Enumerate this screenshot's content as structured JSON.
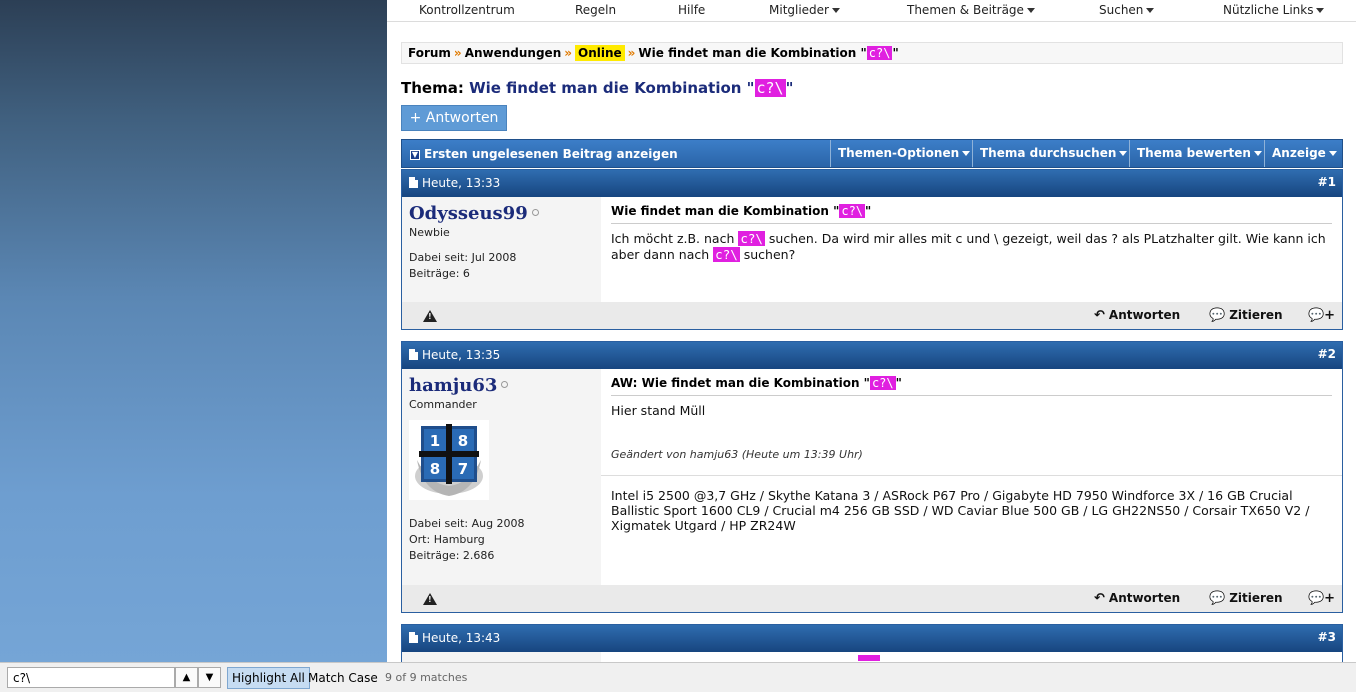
{
  "nav": {
    "items": [
      {
        "label": "Kontrollzentrum",
        "dropdown": false
      },
      {
        "label": "Regeln",
        "dropdown": false
      },
      {
        "label": "Hilfe",
        "dropdown": false
      },
      {
        "label": "Mitglieder",
        "dropdown": true
      },
      {
        "label": "Themen & Beiträge",
        "dropdown": true
      },
      {
        "label": "Suchen",
        "dropdown": true
      },
      {
        "label": "Nützliche Links",
        "dropdown": true
      }
    ]
  },
  "breadcrumb": {
    "forum": "Forum",
    "anwendungen": "Anwendungen",
    "online": "Online",
    "thread": "Wie findet man die Kombination \"",
    "hl": "c?\\",
    "end": "\"",
    "sep": "»"
  },
  "thread": {
    "prefix": "Thema:",
    "title_a": "Wie findet man die Kombination \"",
    "hl": "c?\\",
    "title_b": "\""
  },
  "reply_button": "+ Antworten",
  "tools": {
    "first_unread": "Ersten ungelesenen Beitrag anzeigen",
    "options": "Themen-Optionen",
    "search": "Thema durchsuchen",
    "rate": "Thema bewerten",
    "display": "Anzeige"
  },
  "posts": [
    {
      "date": "Heute, 13:33",
      "num": "#1",
      "username": "Odysseus99",
      "usertitle": "Newbie",
      "joined": "Dabei seit: Jul 2008",
      "posts": "Beiträge: 6",
      "title_a": "Wie findet man die Kombination \"",
      "title_hl": "c?\\",
      "title_b": "\"",
      "text_a": "Ich möcht z.B. nach ",
      "text_hl1": "c?\\",
      "text_b": " suchen. Da wird mir alles mit c und \\ gezeigt, weil das ? als PLatzhalter gilt. Wie kann ich aber dann nach ",
      "text_hl2": "c?\\",
      "text_c": " suchen?",
      "reply": "Antworten",
      "quote": "Zitieren"
    },
    {
      "date": "Heute, 13:35",
      "num": "#2",
      "username": "hamju63",
      "usertitle": "Commander",
      "joined": "Dabei seit: Aug 2008",
      "location": "Ort: Hamburg",
      "posts": "Beiträge: 2.686",
      "title_a": "AW: Wie findet man die Kombination \"",
      "title_hl": "c?\\",
      "title_b": "\"",
      "text": "Hier stand Müll",
      "edit_a": "Geändert von hamju63 (Heute um ",
      "edit_time": "13:39",
      "edit_b": " Uhr)",
      "signature": "Intel i5 2500 @3,7 GHz / Skythe Katana 3 / ASRock P67 Pro / Gigabyte HD 7950 Windforce 3X / 16 GB Crucial Ballistic Sport 1600 CL9 / Crucial m4 256 GB SSD / WD Caviar Blue 500 GB / LG GH22NS50 / Corsair TX650 V2 / Xigmatek Utgard / HP ZR24W",
      "avatar_digits": [
        "1",
        "8",
        "8",
        "7"
      ],
      "reply": "Antworten",
      "quote": "Zitieren"
    },
    {
      "date": "Heute, 13:43",
      "num": "#3"
    }
  ],
  "findbar": {
    "value": "c?\\",
    "highlight_all": "Highlight All",
    "match_case": "Match Case",
    "count": "9 of 9 matches"
  },
  "colors": {
    "accent": "#2a5fa0",
    "highlight": "#e020e0",
    "online_highlight": "#ffea00",
    "username": "#1b2b7a"
  }
}
